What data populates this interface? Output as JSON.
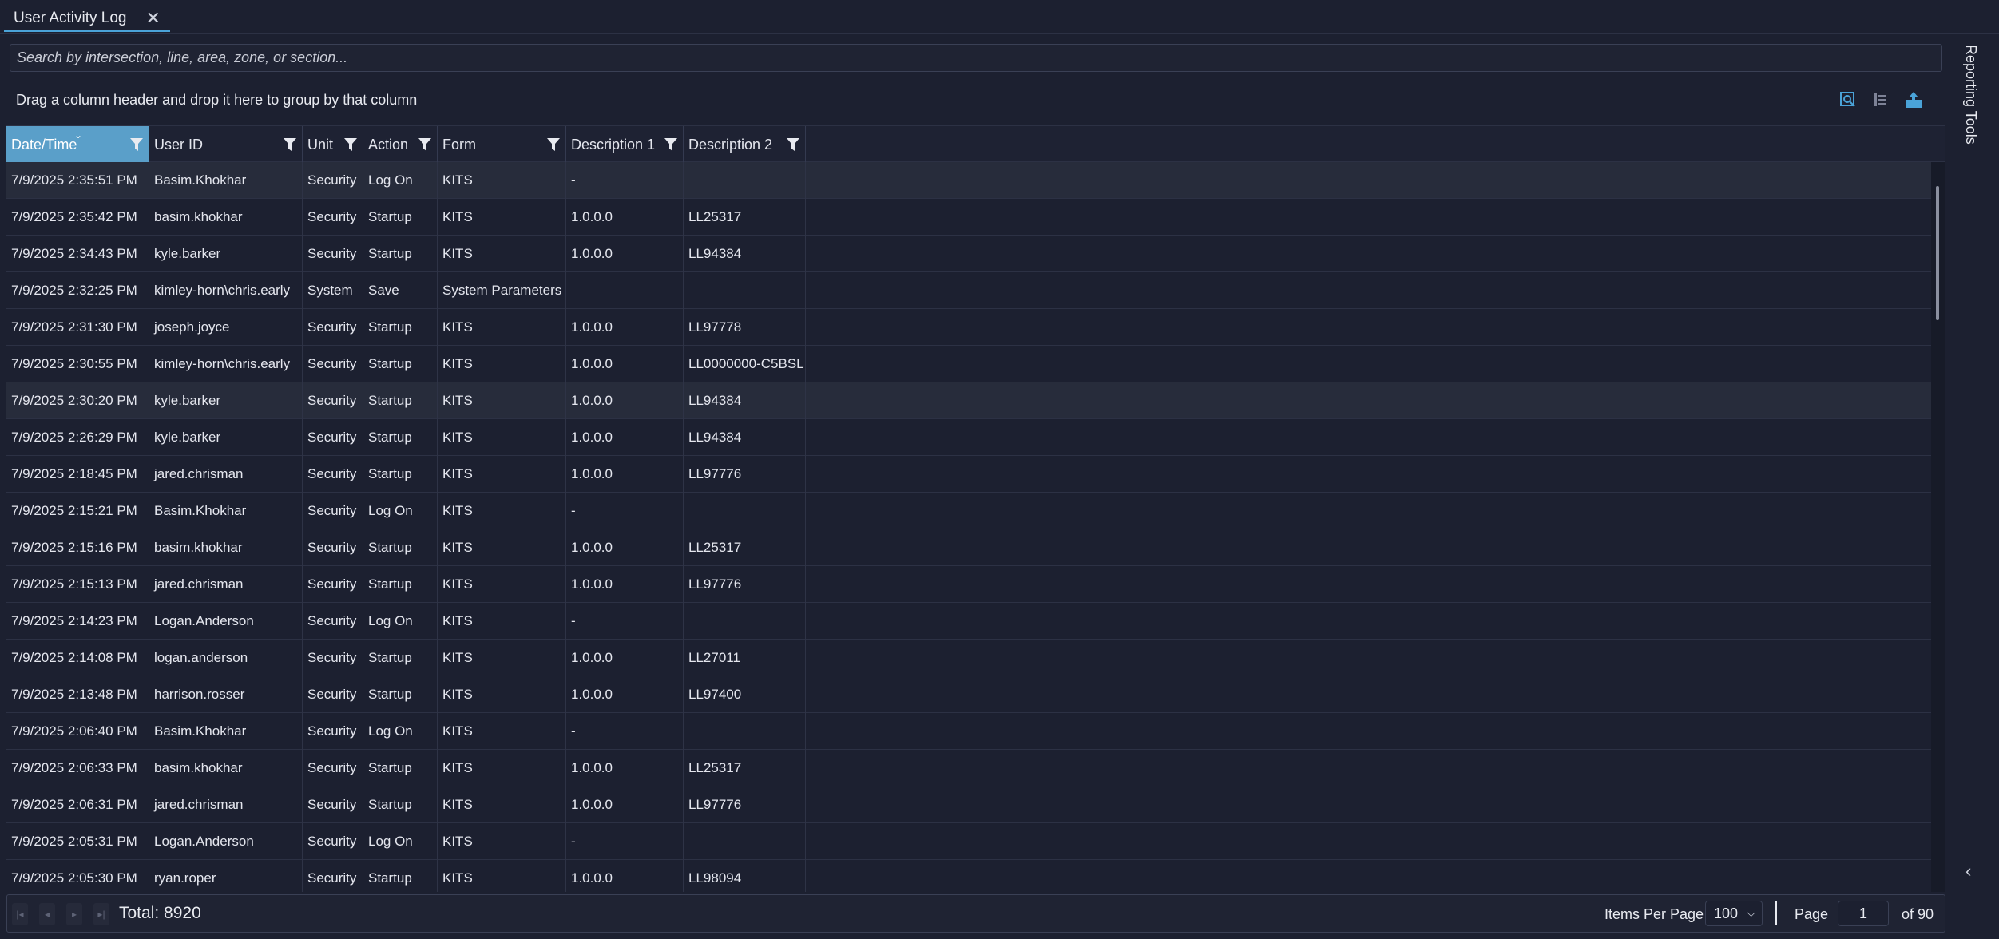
{
  "tab": {
    "title": "User Activity Log",
    "close_glyph": "✕"
  },
  "search": {
    "placeholder": "Search by intersection, line, area, zone, or section..."
  },
  "group_panel": {
    "hint": "Drag a column header and drop it here to group by that column"
  },
  "toolbar_icons": [
    "search-icon",
    "column-chooser-icon",
    "export-icon"
  ],
  "colors": {
    "accent": "#4aa3d8",
    "sorted_header": "#5a9fc9",
    "background": "#1c2030"
  },
  "grid": {
    "columns": [
      "Date/Time",
      "User ID",
      "Unit",
      "Action",
      "Form",
      "Description 1",
      "Description 2"
    ],
    "sorted_column": "Date/Time",
    "rows": [
      [
        "7/9/2025 2:35:51 PM",
        "Basim.Khokhar",
        "Security",
        "Log On",
        "KITS",
        "-",
        ""
      ],
      [
        "7/9/2025 2:35:42 PM",
        "basim.khokhar",
        "Security",
        "Startup",
        "KITS",
        "1.0.0.0",
        "LL25317"
      ],
      [
        "7/9/2025 2:34:43 PM",
        "kyle.barker",
        "Security",
        "Startup",
        "KITS",
        "1.0.0.0",
        "LL94384"
      ],
      [
        "7/9/2025 2:32:25 PM",
        "kimley-horn\\chris.early",
        "System",
        "Save",
        "System Parameters",
        "",
        ""
      ],
      [
        "7/9/2025 2:31:30 PM",
        "joseph.joyce",
        "Security",
        "Startup",
        "KITS",
        "1.0.0.0",
        "LL97778"
      ],
      [
        "7/9/2025 2:30:55 PM",
        "kimley-horn\\chris.early",
        "Security",
        "Startup",
        "KITS",
        "1.0.0.0",
        "LL0000000-C5BSL"
      ],
      [
        "7/9/2025 2:30:20 PM",
        "kyle.barker",
        "Security",
        "Startup",
        "KITS",
        "1.0.0.0",
        "LL94384"
      ],
      [
        "7/9/2025 2:26:29 PM",
        "kyle.barker",
        "Security",
        "Startup",
        "KITS",
        "1.0.0.0",
        "LL94384"
      ],
      [
        "7/9/2025 2:18:45 PM",
        "jared.chrisman",
        "Security",
        "Startup",
        "KITS",
        "1.0.0.0",
        "LL97776"
      ],
      [
        "7/9/2025 2:15:21 PM",
        "Basim.Khokhar",
        "Security",
        "Log On",
        "KITS",
        "-",
        ""
      ],
      [
        "7/9/2025 2:15:16 PM",
        "basim.khokhar",
        "Security",
        "Startup",
        "KITS",
        "1.0.0.0",
        "LL25317"
      ],
      [
        "7/9/2025 2:15:13 PM",
        "jared.chrisman",
        "Security",
        "Startup",
        "KITS",
        "1.0.0.0",
        "LL97776"
      ],
      [
        "7/9/2025 2:14:23 PM",
        "Logan.Anderson",
        "Security",
        "Log On",
        "KITS",
        "-",
        ""
      ],
      [
        "7/9/2025 2:14:08 PM",
        "logan.anderson",
        "Security",
        "Startup",
        "KITS",
        "1.0.0.0",
        "LL27011"
      ],
      [
        "7/9/2025 2:13:48 PM",
        "harrison.rosser",
        "Security",
        "Startup",
        "KITS",
        "1.0.0.0",
        "LL97400"
      ],
      [
        "7/9/2025 2:06:40 PM",
        "Basim.Khokhar",
        "Security",
        "Log On",
        "KITS",
        "-",
        ""
      ],
      [
        "7/9/2025 2:06:33 PM",
        "basim.khokhar",
        "Security",
        "Startup",
        "KITS",
        "1.0.0.0",
        "LL25317"
      ],
      [
        "7/9/2025 2:06:31 PM",
        "jared.chrisman",
        "Security",
        "Startup",
        "KITS",
        "1.0.0.0",
        "LL97776"
      ],
      [
        "7/9/2025 2:05:31 PM",
        "Logan.Anderson",
        "Security",
        "Log On",
        "KITS",
        "-",
        ""
      ],
      [
        "7/9/2025 2:05:30 PM",
        "ryan.roper",
        "Security",
        "Startup",
        "KITS",
        "1.0.0.0",
        "LL98094"
      ]
    ]
  },
  "pager": {
    "total": "Total: 8920",
    "items_per_page_label": "Items Per Page",
    "items_per_page": "100",
    "page_label": "Page",
    "page": "1",
    "of_label": "of  90"
  },
  "side_panel": {
    "title": "Reporting Tools",
    "collapse_glyph": "‹"
  }
}
